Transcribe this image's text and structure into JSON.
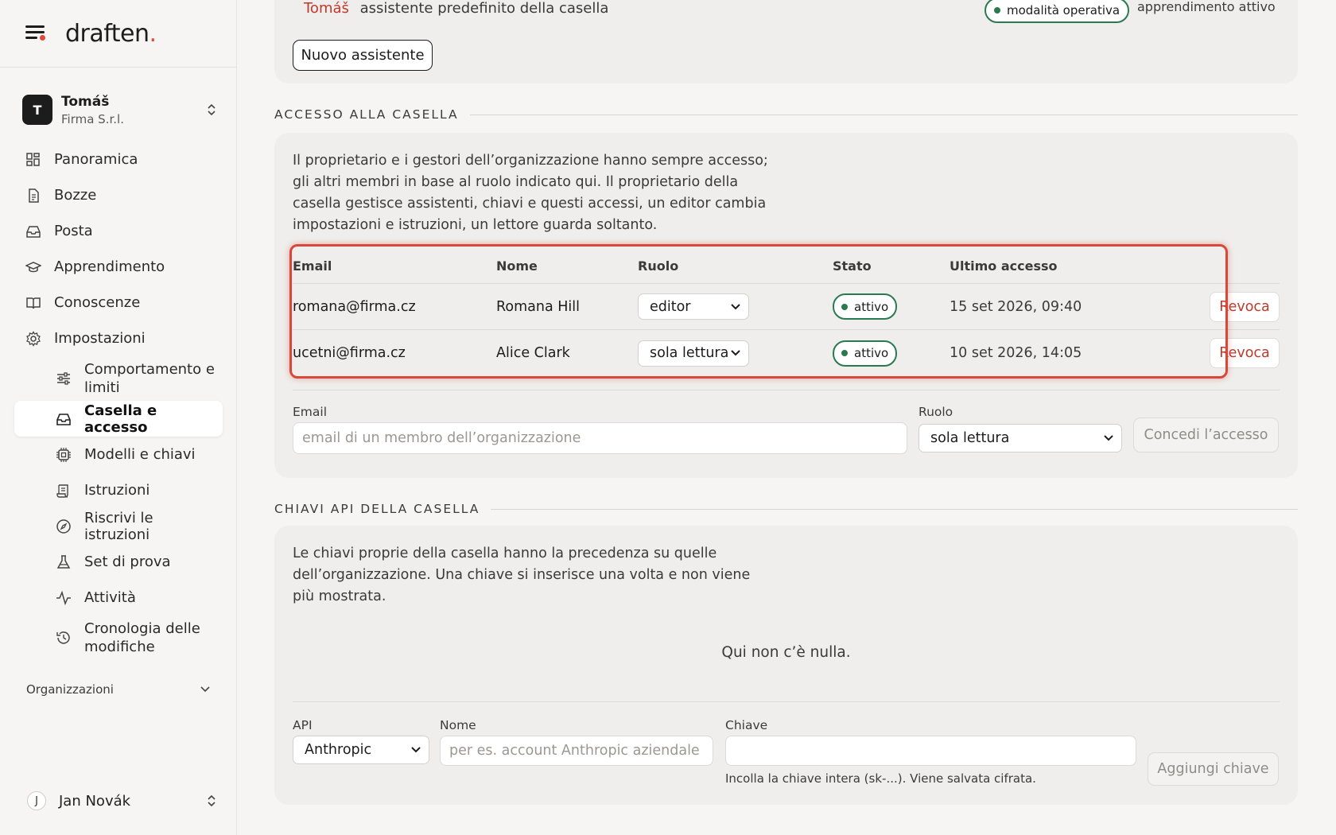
{
  "brand": {
    "name": "draften",
    "dot": "."
  },
  "account": {
    "initial": "T",
    "name": "Tomáš",
    "org": "Firma S.r.l."
  },
  "nav": {
    "items": [
      {
        "label": "Panoramica"
      },
      {
        "label": "Bozze"
      },
      {
        "label": "Posta"
      },
      {
        "label": "Apprendimento"
      },
      {
        "label": "Conoscenze"
      },
      {
        "label": "Impostazioni"
      }
    ],
    "settings_sub": [
      {
        "label": "Comportamento e limiti"
      },
      {
        "label": "Casella e accesso"
      },
      {
        "label": "Modelli e chiavi"
      },
      {
        "label": "Istruzioni"
      },
      {
        "label": "Riscrivi le istruzioni"
      },
      {
        "label": "Set di prova"
      },
      {
        "label": "Attività"
      },
      {
        "label": "Cronologia delle modifiche"
      }
    ],
    "organizations_label": "Organizzazioni"
  },
  "user": {
    "initial": "J",
    "name": "Jan Novák"
  },
  "assistant": {
    "owner": "Tomáš",
    "description": "assistente predefinito della casella",
    "mode_badge": "modalità operativa",
    "learning": "apprendimento attivo",
    "new_button": "Nuovo assistente"
  },
  "access": {
    "section_title": "ACCESSO ALLA CASELLA",
    "description": "Il proprietario e i gestori dell’organizzazione hanno sempre accesso; gli altri membri in base al ruolo indicato qui. Il proprietario della casella gestisce assistenti, chiavi e questi accessi, un editor cambia impostazioni e istruzioni, un lettore guarda soltanto.",
    "columns": {
      "email": "Email",
      "name": "Nome",
      "role": "Ruolo",
      "status": "Stato",
      "last": "Ultimo accesso"
    },
    "rows": [
      {
        "email": "romana@firma.cz",
        "name": "Romana Hill",
        "role": "editor",
        "status": "attivo",
        "last": "15 set 2026, 09:40",
        "action": "Revoca"
      },
      {
        "email": "ucetni@firma.cz",
        "name": "Alice Clark",
        "role": "sola lettura",
        "status": "attivo",
        "last": "10 set 2026, 14:05",
        "action": "Revoca"
      }
    ],
    "form": {
      "email_label": "Email",
      "email_placeholder": "email di un membro dell’organizzazione",
      "role_label": "Ruolo",
      "role_value": "sola lettura",
      "grant_button": "Concedi l’accesso"
    }
  },
  "keys": {
    "section_title": "CHIAVI API DELLA CASELLA",
    "description": "Le chiavi proprie della casella hanno la precedenza su quelle dell’organizzazione. Una chiave si inserisce una volta e non viene più mostrata.",
    "empty": "Qui non c’è nulla.",
    "form": {
      "api_label": "API",
      "api_value": "Anthropic",
      "name_label": "Nome",
      "name_placeholder": "per es. account Anthropic aziendale",
      "key_label": "Chiave",
      "key_value": "",
      "key_hint": "Incolla la chiave intera (sk-...). Viene salvata cifrata.",
      "add_button": "Aggiungi chiave"
    }
  },
  "colors": {
    "accent": "#e0483a",
    "danger": "#c0392b",
    "success": "#2a7a4f",
    "highlight": "#d9463a"
  }
}
